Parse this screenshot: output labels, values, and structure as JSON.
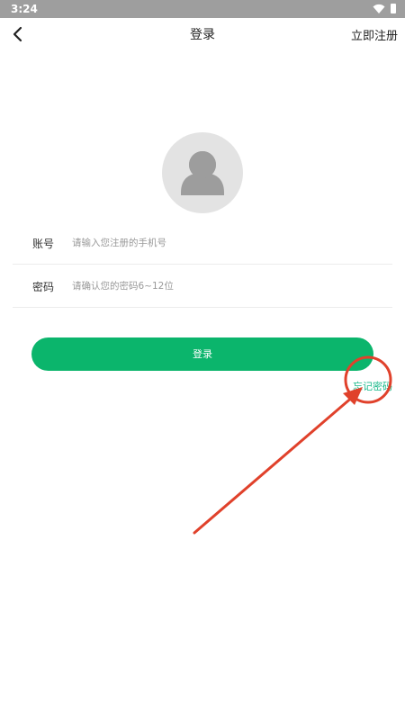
{
  "status_bar": {
    "time": "3:24"
  },
  "header": {
    "back_icon": "chevron-left-icon",
    "title": "登录",
    "register_label": "立即注册"
  },
  "avatar": {
    "icon": "user-silhouette-icon"
  },
  "form": {
    "account_label": "账号",
    "account_placeholder": "请输入您注册的手机号",
    "password_label": "密码",
    "password_placeholder": "请确认您的密码6~12位"
  },
  "login_button_label": "登录",
  "forgot_password_label": "忘记密码",
  "colors": {
    "accent": "#0bb56c",
    "link": "#19b98a",
    "annotation": "#e0412b"
  }
}
